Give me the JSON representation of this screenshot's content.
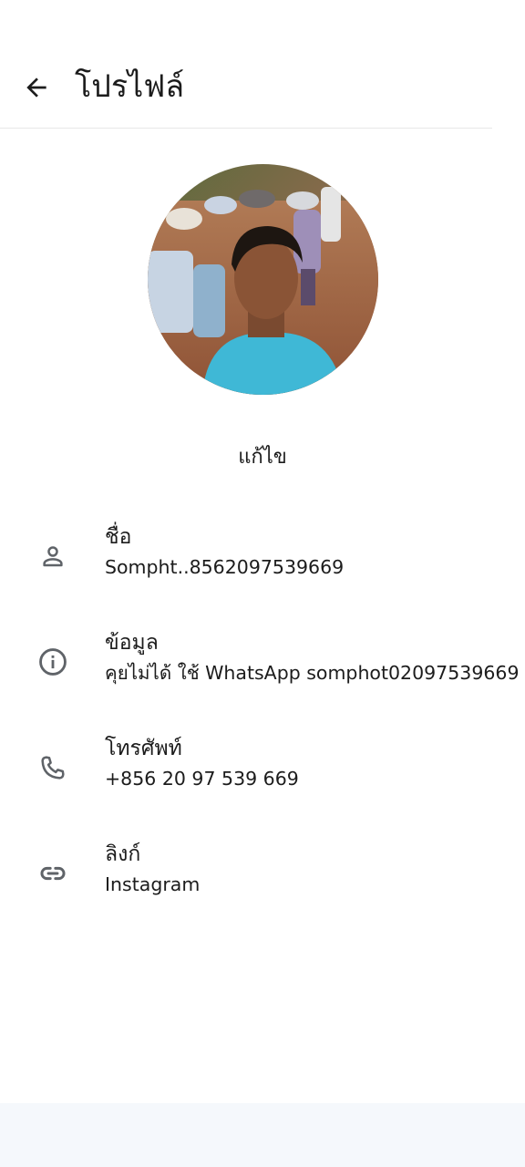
{
  "header": {
    "title": "โปรไฟล์"
  },
  "profile": {
    "edit_label": "แก้ไข"
  },
  "fields": [
    {
      "icon": "person-icon",
      "label": "ชื่อ",
      "value": "Sompht..8562097539669"
    },
    {
      "icon": "info-icon",
      "label": "ข้อมูล",
      "value": "คุยไม่ได้ ใช้ WhatsApp somphot02097539669"
    },
    {
      "icon": "phone-icon",
      "label": "โทรศัพท์",
      "value": "+856 20 97 539 669"
    },
    {
      "icon": "link-icon",
      "label": "ลิงก์",
      "value": "Instagram"
    }
  ]
}
